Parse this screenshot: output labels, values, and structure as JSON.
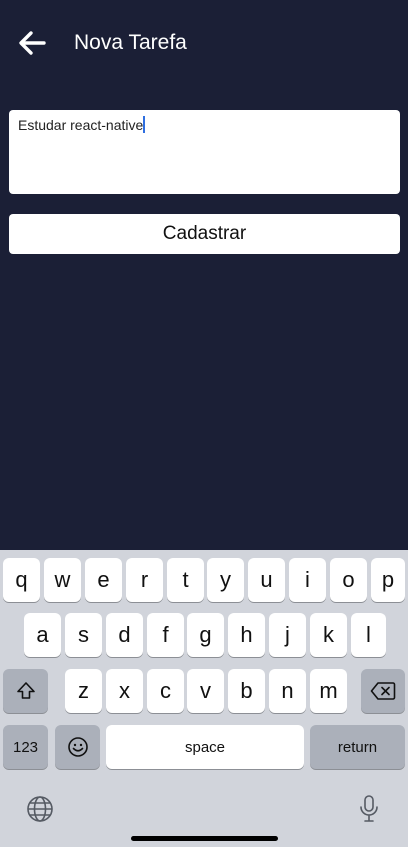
{
  "header": {
    "title": "Nova Tarefa",
    "back_icon": "arrow-left-icon"
  },
  "form": {
    "task_value": "Estudar react-native",
    "submit_label": "Cadastrar"
  },
  "keyboard": {
    "row1": [
      "q",
      "w",
      "e",
      "r",
      "t",
      "y",
      "u",
      "i",
      "o",
      "p"
    ],
    "row2": [
      "a",
      "s",
      "d",
      "f",
      "g",
      "h",
      "j",
      "k",
      "l"
    ],
    "row3": [
      "z",
      "x",
      "c",
      "v",
      "b",
      "n",
      "m"
    ],
    "numbers_label": "123",
    "space_label": "space",
    "return_label": "return",
    "icons": {
      "shift": "shift-icon",
      "backspace": "backspace-icon",
      "emoji": "emoji-icon",
      "globe": "globe-icon",
      "mic": "microphone-icon"
    }
  },
  "colors": {
    "background": "#1b1f36",
    "caret": "#2f6fe0",
    "keyboard_bg": "#d1d4db"
  }
}
